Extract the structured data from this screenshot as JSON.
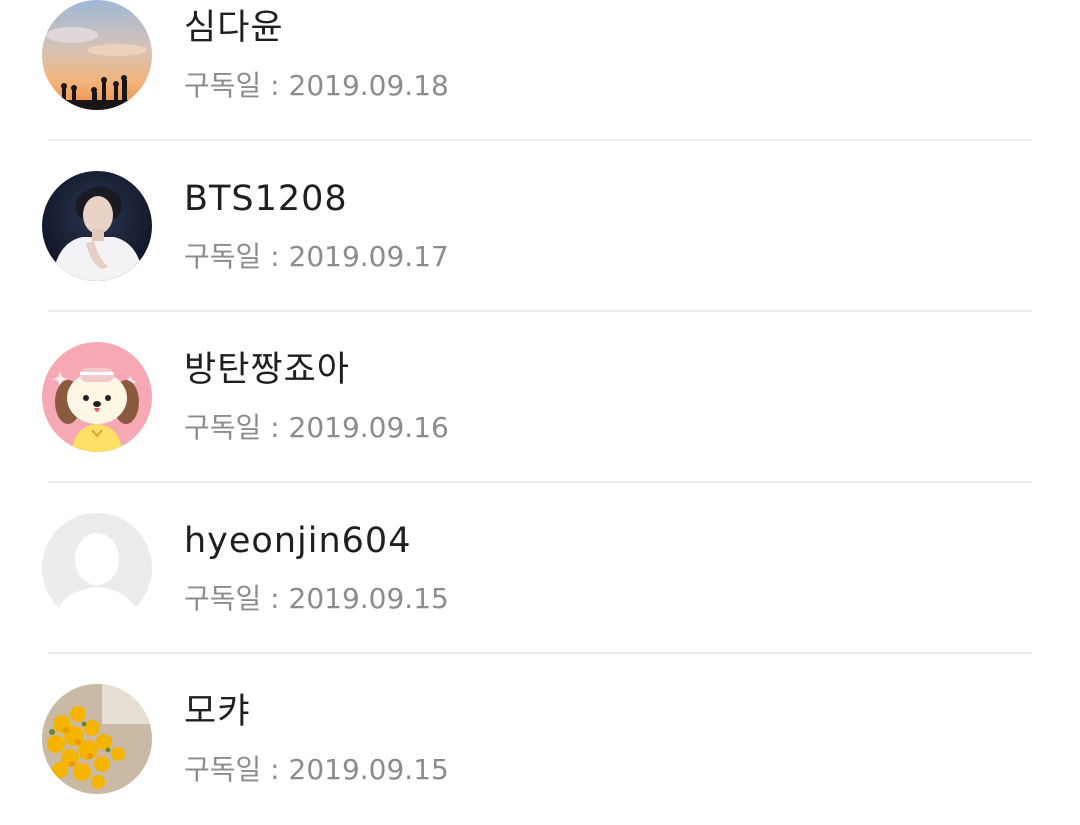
{
  "subscribers": [
    {
      "name": "심다윤",
      "date_text": "구독일 : 2019.09.18",
      "avatar": "sunset-silhouette-photo"
    },
    {
      "name": "BTS1208",
      "date_text": "구독일 : 2019.09.17",
      "avatar": "person-portrait-photo"
    },
    {
      "name": "방탄짱죠아",
      "date_text": "구독일 : 2019.09.16",
      "avatar": "cartoon-puppy-character"
    },
    {
      "name": "hyeonjin604",
      "date_text": "구독일 : 2019.09.15",
      "avatar": "default-user-icon"
    },
    {
      "name": "모캬",
      "date_text": "구독일 : 2019.09.15",
      "avatar": "yellow-flowers-photo"
    }
  ]
}
